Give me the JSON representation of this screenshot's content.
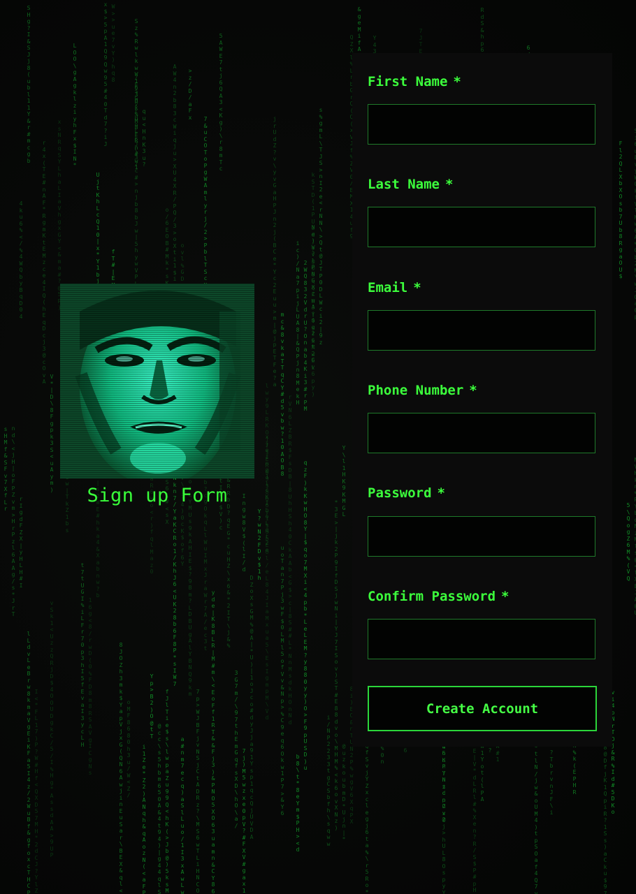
{
  "theme": {
    "accent": "#39ff3a",
    "rain": "#13a62c",
    "background": "#070807",
    "panel": "#0b0b0b",
    "input_border": "#1f7a2a",
    "avatar_tint": "#1de9b6"
  },
  "hero": {
    "avatar_icon": "avatar-face-icon",
    "title": "Sign up Form"
  },
  "form": {
    "fields": [
      {
        "label": "First Name",
        "required_mark": "*",
        "value": "",
        "placeholder": ""
      },
      {
        "label": "Last Name",
        "required_mark": "*",
        "value": "",
        "placeholder": ""
      },
      {
        "label": "Email",
        "required_mark": "*",
        "value": "",
        "placeholder": ""
      },
      {
        "label": "Phone Number",
        "required_mark": "*",
        "value": "",
        "placeholder": ""
      },
      {
        "label": "Password",
        "required_mark": "*",
        "value": "",
        "placeholder": ""
      },
      {
        "label": "Confirm Password",
        "required_mark": "*",
        "value": "",
        "placeholder": ""
      }
    ],
    "submit_label": "Create Account"
  }
}
